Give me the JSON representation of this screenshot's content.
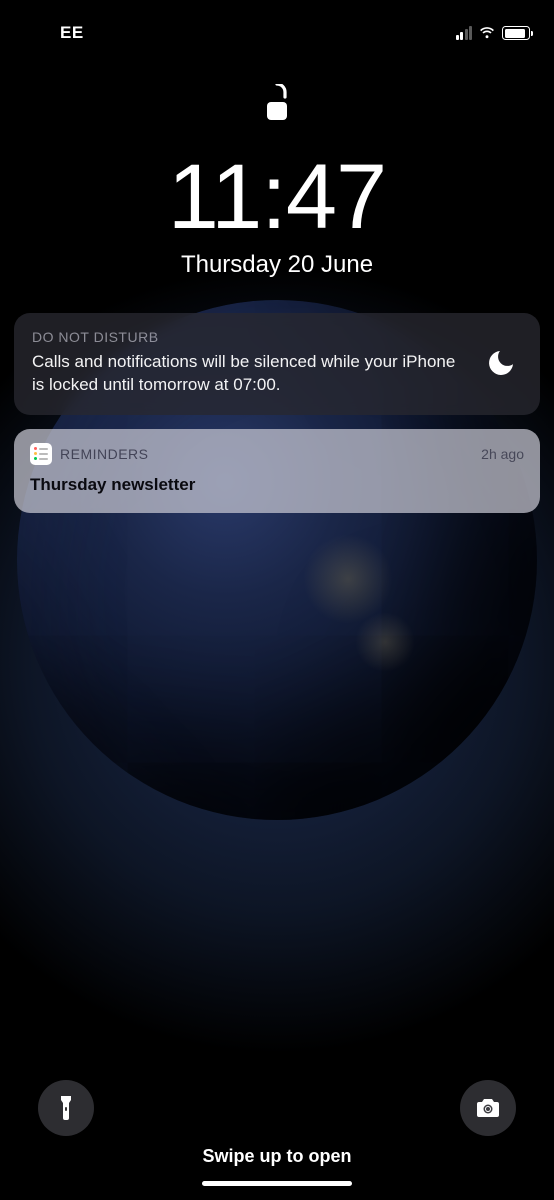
{
  "status": {
    "carrier": "EE",
    "signal_active_bars": 2,
    "wifi_icon": "wifi-icon",
    "battery_level_pct": 90
  },
  "lock": {
    "time": "11:47",
    "date": "Thursday 20 June",
    "lock_state": "unlocked"
  },
  "dnd": {
    "header": "DO NOT DISTURB",
    "body": "Calls and notifications will be silenced while your iPhone is locked until tomorrow at 07:00.",
    "icon": "moon-icon"
  },
  "notification": {
    "app_name": "REMINDERS",
    "app_icon": "reminders-app-icon",
    "time_ago": "2h ago",
    "title": "Thursday newsletter"
  },
  "bottom": {
    "swipe_label": "Swipe up to open",
    "flashlight_icon": "flashlight-icon",
    "camera_icon": "camera-icon"
  }
}
